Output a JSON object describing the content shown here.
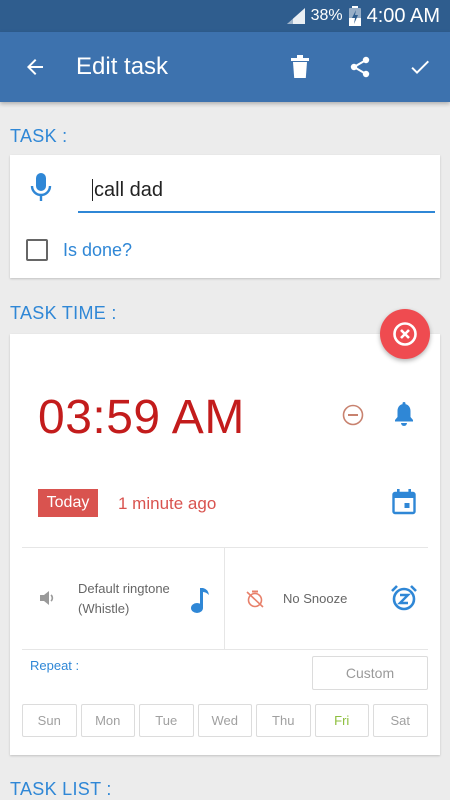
{
  "status_bar": {
    "battery": "38%",
    "time": "4:00 AM"
  },
  "app_bar": {
    "title": "Edit task",
    "icons": [
      "back-arrow-icon",
      "trash-icon",
      "share-icon",
      "check-icon"
    ]
  },
  "task_section": {
    "label": "TASK :",
    "input_value": "call dad",
    "done_label": "Is done?",
    "done_checked": false
  },
  "time_section": {
    "label": "TASK TIME :",
    "time": "03:59 AM",
    "date_badge": "Today",
    "relative": "1 minute ago",
    "ringtone_line1": "Default ringtone",
    "ringtone_line2": "(Whistle)",
    "snooze": "No Snooze",
    "repeat_label": "Repeat :",
    "custom_label": "Custom",
    "days": [
      "Sun",
      "Mon",
      "Tue",
      "Wed",
      "Thu",
      "Fri",
      "Sat"
    ],
    "active_day": "Fri"
  },
  "list_section": {
    "label": "TASK LIST :"
  },
  "colors": {
    "primary": "#3d72ae",
    "status": "#2f5d8e",
    "accent": "#2f87d6",
    "time_red": "#c31c1c",
    "badge_red": "#d9534f",
    "fab": "#ef4b50",
    "active_day": "#8dbf3e"
  }
}
